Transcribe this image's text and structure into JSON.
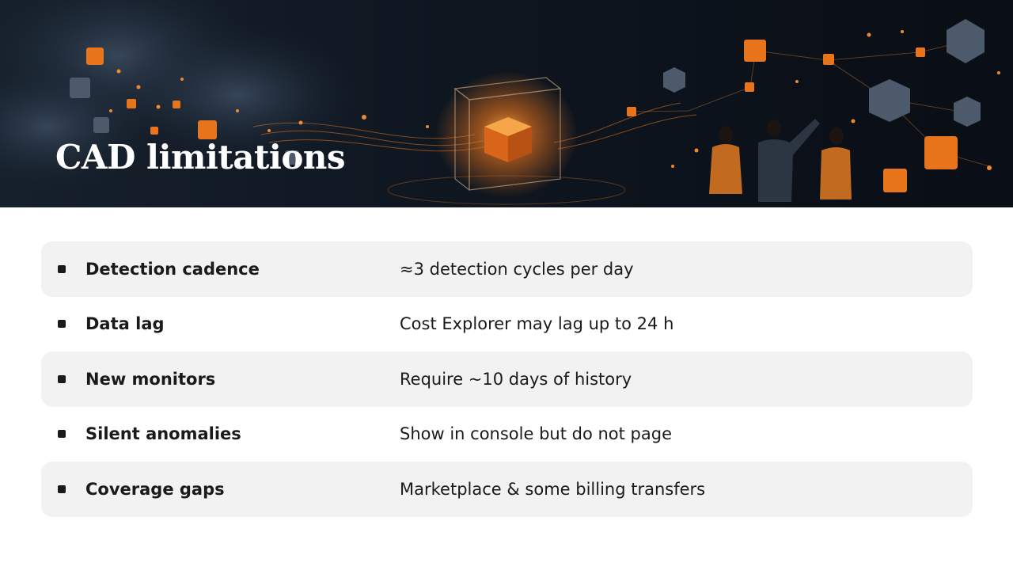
{
  "slide": {
    "title": "CAD limitations",
    "banner_image": "abstract-network-cubes-with-people-illustration"
  },
  "rows": [
    {
      "label": "Detection cadence",
      "value": "≈3 detection cycles per day",
      "shaded": true
    },
    {
      "label": "Data lag",
      "value": "Cost Explorer may lag up to 24 h",
      "shaded": false
    },
    {
      "label": "New monitors",
      "value": "Require ~10 days of history",
      "shaded": true
    },
    {
      "label": "Silent anomalies",
      "value": "Show in console but do not page",
      "shaded": false
    },
    {
      "label": "Coverage gaps",
      "value": "Marketplace & some billing transfers",
      "shaded": true
    }
  ],
  "colors": {
    "accent_orange": "#e8741c",
    "banner_dark": "#0e1620",
    "row_shade": "#f2f2f2",
    "text": "#1a1a1a"
  }
}
